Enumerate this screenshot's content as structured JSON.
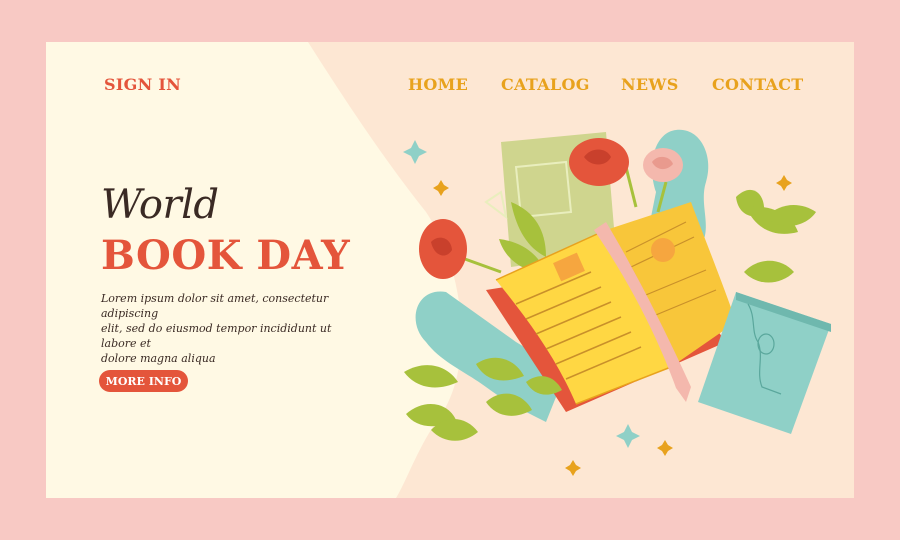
{
  "colors": {
    "page_bg": "#f8c9c4",
    "card_bg": "#fff9e4",
    "accent_red": "#e4553b",
    "nav_gold": "#e8a21d",
    "leaf_green": "#a7c13c",
    "teal": "#8fd0c7"
  },
  "nav": {
    "sign_in": "SIGN IN",
    "links": [
      "HOME",
      "CATALOG",
      "NEWS",
      "CONTACT"
    ]
  },
  "hero": {
    "script_title": "World",
    "main_title": "BOOK DAY",
    "body_lines": [
      "Lorem ipsum dolor sit amet, consectetur adipiscing",
      "elit, sed do eiusmod tempor incididunt ut labore et",
      "dolore magna aliqua"
    ],
    "button_label": "MORE INFO"
  },
  "illustration": {
    "icons": [
      "open-book-icon",
      "closed-book-icon",
      "rose-icon",
      "leaf-icon",
      "sparkle-icon",
      "bookmark-ribbon-icon"
    ]
  }
}
